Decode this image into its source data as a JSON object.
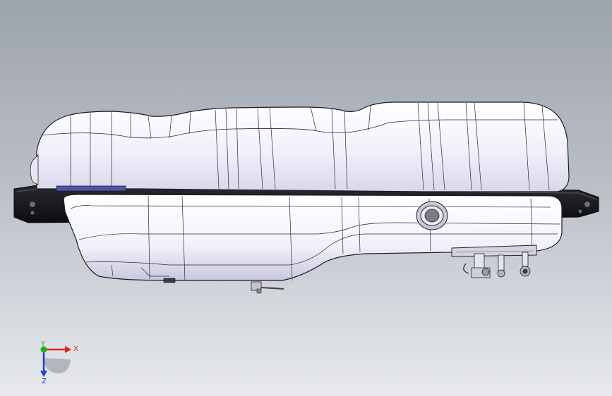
{
  "viewport": {
    "background_top": "#9da3ad",
    "background_bottom": "#e7e9ed",
    "model_name": "",
    "model_icon": "fuel-tank-3d-model"
  },
  "triad": {
    "x_label": "X",
    "y_label": "Y",
    "z_label": "Z",
    "x_color": "#e0241b",
    "y_color": "#1bb21b",
    "z_color": "#1e3fd1"
  }
}
